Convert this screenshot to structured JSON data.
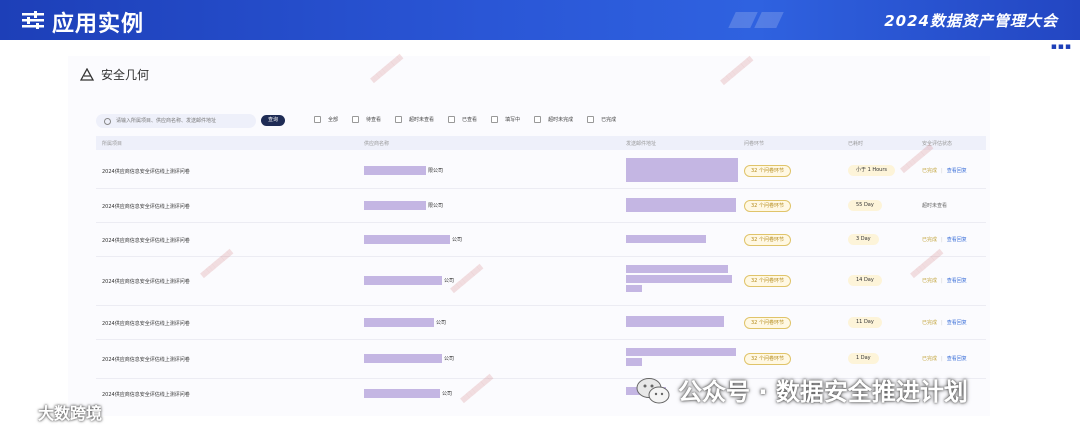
{
  "header": {
    "title": "应用实例",
    "conference": "2024数据资产管理大会"
  },
  "card": {
    "title": "安全几何"
  },
  "search": {
    "placeholder": "请输入所属项目、供应商名称、发送邮件地址",
    "button": "查询"
  },
  "filters": [
    "全部",
    "待查看",
    "超时未查看",
    "已查看",
    "填写中",
    "超时未完成",
    "已完成"
  ],
  "table": {
    "headers": [
      "所属项目",
      "供应商名称",
      "发送邮件地址",
      "问卷环节",
      "已耗时",
      "安全评估状态"
    ],
    "rows": [
      {
        "project": "2024供应商信息安全评估线上测评问卷",
        "supplier_suffix": "限公司",
        "phase": "32 个问卷环节",
        "duration": "小于 1 Hours",
        "status": "已完成",
        "action": "查看回复"
      },
      {
        "project": "2024供应商信息安全评估线上测评问卷",
        "supplier_suffix": "限公司",
        "phase": "32 个问卷环节",
        "duration": "55 Day",
        "status": "超时未查看",
        "action": ""
      },
      {
        "project": "2024供应商信息安全评估线上测评问卷",
        "supplier_suffix": "公司",
        "phase": "32 个问卷环节",
        "duration": "3 Day",
        "status": "已完成",
        "action": "查看回复"
      },
      {
        "project": "2024供应商信息安全评估线上测评问卷",
        "supplier_suffix": "公司",
        "phase": "32 个问卷环节",
        "duration": "14 Day",
        "status": "已完成",
        "action": "查看回复"
      },
      {
        "project": "2024供应商信息安全评估线上测评问卷",
        "supplier_suffix": "公司",
        "phase": "32 个问卷环节",
        "duration": "11 Day",
        "status": "已完成",
        "action": "查看回复"
      },
      {
        "project": "2024供应商信息安全评估线上测评问卷",
        "supplier_suffix": "公司",
        "phase": "32 个问卷环节",
        "duration": "1 Day",
        "status": "已完成",
        "action": "查看回复"
      },
      {
        "project": "2024供应商信息安全评估线上测评问卷",
        "supplier_suffix": "公司",
        "phase": "32 个问卷环节",
        "duration": "",
        "status": "",
        "action": ""
      }
    ]
  },
  "footer": {
    "left_brand": "大数跨境",
    "right_brand": "公众号 · 数据安全推进计划"
  },
  "colors": {
    "banner": "#2a56d6",
    "redaction": "#c4b6e3",
    "phase_badge": "#e0c46a",
    "link": "#3b6fd8"
  }
}
